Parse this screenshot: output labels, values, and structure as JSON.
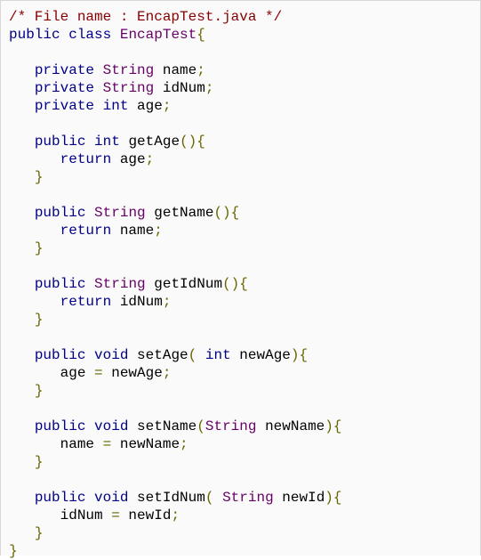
{
  "colors": {
    "background": "#fafafa",
    "border": "#d8d8d8",
    "comment": "#880000",
    "keyword": "#000088",
    "type": "#660066",
    "plain": "#000000",
    "punctuation": "#666600"
  },
  "code": {
    "language": "java",
    "lines": [
      [
        [
          "com",
          "/* File name : EncapTest.java */"
        ]
      ],
      [
        [
          "kwd",
          "public"
        ],
        [
          "pln",
          " "
        ],
        [
          "kwd",
          "class"
        ],
        [
          "pln",
          " "
        ],
        [
          "typ",
          "EncapTest"
        ],
        [
          "pun",
          "{"
        ]
      ],
      [],
      [
        [
          "pln",
          "   "
        ],
        [
          "kwd",
          "private"
        ],
        [
          "pln",
          " "
        ],
        [
          "typ",
          "String"
        ],
        [
          "pln",
          " name"
        ],
        [
          "pun",
          ";"
        ]
      ],
      [
        [
          "pln",
          "   "
        ],
        [
          "kwd",
          "private"
        ],
        [
          "pln",
          " "
        ],
        [
          "typ",
          "String"
        ],
        [
          "pln",
          " idNum"
        ],
        [
          "pun",
          ";"
        ]
      ],
      [
        [
          "pln",
          "   "
        ],
        [
          "kwd",
          "private"
        ],
        [
          "pln",
          " "
        ],
        [
          "kwd",
          "int"
        ],
        [
          "pln",
          " age"
        ],
        [
          "pun",
          ";"
        ]
      ],
      [],
      [
        [
          "pln",
          "   "
        ],
        [
          "kwd",
          "public"
        ],
        [
          "pln",
          " "
        ],
        [
          "kwd",
          "int"
        ],
        [
          "pln",
          " getAge"
        ],
        [
          "pun",
          "(){"
        ]
      ],
      [
        [
          "pln",
          "      "
        ],
        [
          "kwd",
          "return"
        ],
        [
          "pln",
          " age"
        ],
        [
          "pun",
          ";"
        ]
      ],
      [
        [
          "pln",
          "   "
        ],
        [
          "pun",
          "}"
        ]
      ],
      [],
      [
        [
          "pln",
          "   "
        ],
        [
          "kwd",
          "public"
        ],
        [
          "pln",
          " "
        ],
        [
          "typ",
          "String"
        ],
        [
          "pln",
          " getName"
        ],
        [
          "pun",
          "(){"
        ]
      ],
      [
        [
          "pln",
          "      "
        ],
        [
          "kwd",
          "return"
        ],
        [
          "pln",
          " name"
        ],
        [
          "pun",
          ";"
        ]
      ],
      [
        [
          "pln",
          "   "
        ],
        [
          "pun",
          "}"
        ]
      ],
      [],
      [
        [
          "pln",
          "   "
        ],
        [
          "kwd",
          "public"
        ],
        [
          "pln",
          " "
        ],
        [
          "typ",
          "String"
        ],
        [
          "pln",
          " getIdNum"
        ],
        [
          "pun",
          "(){"
        ]
      ],
      [
        [
          "pln",
          "      "
        ],
        [
          "kwd",
          "return"
        ],
        [
          "pln",
          " idNum"
        ],
        [
          "pun",
          ";"
        ]
      ],
      [
        [
          "pln",
          "   "
        ],
        [
          "pun",
          "}"
        ]
      ],
      [],
      [
        [
          "pln",
          "   "
        ],
        [
          "kwd",
          "public"
        ],
        [
          "pln",
          " "
        ],
        [
          "kwd",
          "void"
        ],
        [
          "pln",
          " setAge"
        ],
        [
          "pun",
          "("
        ],
        [
          "pln",
          " "
        ],
        [
          "kwd",
          "int"
        ],
        [
          "pln",
          " newAge"
        ],
        [
          "pun",
          "){"
        ]
      ],
      [
        [
          "pln",
          "      age "
        ],
        [
          "pun",
          "="
        ],
        [
          "pln",
          " newAge"
        ],
        [
          "pun",
          ";"
        ]
      ],
      [
        [
          "pln",
          "   "
        ],
        [
          "pun",
          "}"
        ]
      ],
      [],
      [
        [
          "pln",
          "   "
        ],
        [
          "kwd",
          "public"
        ],
        [
          "pln",
          " "
        ],
        [
          "kwd",
          "void"
        ],
        [
          "pln",
          " setName"
        ],
        [
          "pun",
          "("
        ],
        [
          "typ",
          "String"
        ],
        [
          "pln",
          " newName"
        ],
        [
          "pun",
          "){"
        ]
      ],
      [
        [
          "pln",
          "      name "
        ],
        [
          "pun",
          "="
        ],
        [
          "pln",
          " newName"
        ],
        [
          "pun",
          ";"
        ]
      ],
      [
        [
          "pln",
          "   "
        ],
        [
          "pun",
          "}"
        ]
      ],
      [],
      [
        [
          "pln",
          "   "
        ],
        [
          "kwd",
          "public"
        ],
        [
          "pln",
          " "
        ],
        [
          "kwd",
          "void"
        ],
        [
          "pln",
          " setIdNum"
        ],
        [
          "pun",
          "("
        ],
        [
          "pln",
          " "
        ],
        [
          "typ",
          "String"
        ],
        [
          "pln",
          " newId"
        ],
        [
          "pun",
          "){"
        ]
      ],
      [
        [
          "pln",
          "      idNum "
        ],
        [
          "pun",
          "="
        ],
        [
          "pln",
          " newId"
        ],
        [
          "pun",
          ";"
        ]
      ],
      [
        [
          "pln",
          "   "
        ],
        [
          "pun",
          "}"
        ]
      ],
      [
        [
          "pun",
          "}"
        ]
      ]
    ]
  }
}
